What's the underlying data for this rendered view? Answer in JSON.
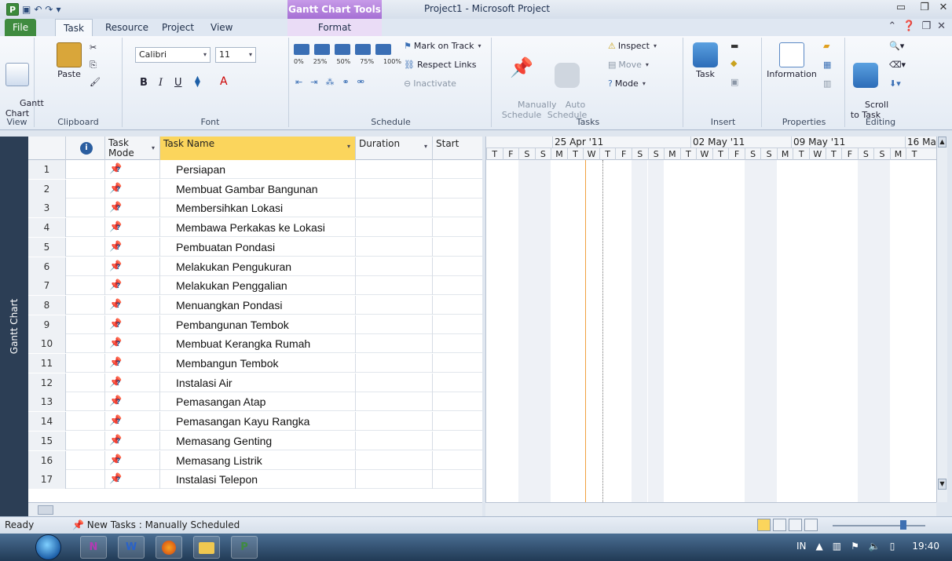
{
  "window": {
    "title": "Project1 - Microsoft Project",
    "context_group": "Gantt Chart Tools"
  },
  "tabs": [
    "File",
    "Task",
    "Resource",
    "Project",
    "View",
    "Format"
  ],
  "ribbon": {
    "view": {
      "gantt_label": "Gantt\nChart",
      "group": "View"
    },
    "clipboard": {
      "paste": "Paste",
      "group": "Clipboard"
    },
    "font": {
      "family": "Calibri",
      "size": "11",
      "bold": "B",
      "italic": "I",
      "underline": "U",
      "group": "Font"
    },
    "schedule": {
      "mark_on_track": "Mark on Track",
      "respect_links": "Respect Links",
      "inactivate": "Inactivate",
      "pct": [
        "0%",
        "25%",
        "50%",
        "75%",
        "100%"
      ],
      "group": "Schedule"
    },
    "tasks": {
      "manually": "Manually\nSchedule",
      "auto": "Auto\nSchedule",
      "inspect": "Inspect",
      "move": "Move",
      "mode": "Mode",
      "group": "Tasks"
    },
    "insert": {
      "task": "Task",
      "group": "Insert"
    },
    "properties": {
      "information": "Information",
      "group": "Properties"
    },
    "editing": {
      "scroll": "Scroll\nto Task",
      "group": "Editing"
    }
  },
  "sidebar_label": "Gantt Chart",
  "grid": {
    "headers": {
      "mode": "Task\nMode",
      "name": "Task Name",
      "duration": "Duration",
      "start": "Start"
    },
    "rows": [
      {
        "id": "1",
        "name": "Persiapan"
      },
      {
        "id": "2",
        "name": "Membuat Gambar Bangunan"
      },
      {
        "id": "3",
        "name": "Membersihkan Lokasi"
      },
      {
        "id": "4",
        "name": "Membawa Perkakas ke Lokasi"
      },
      {
        "id": "5",
        "name": "Pembuatan Pondasi"
      },
      {
        "id": "6",
        "name": "Melakukan Pengukuran"
      },
      {
        "id": "7",
        "name": "Melakukan Penggalian"
      },
      {
        "id": "8",
        "name": "Menuangkan Pondasi"
      },
      {
        "id": "9",
        "name": "Pembangunan Tembok"
      },
      {
        "id": "10",
        "name": "Membuat Kerangka Rumah"
      },
      {
        "id": "11",
        "name": "Membangun Tembok"
      },
      {
        "id": "12",
        "name": "Instalasi Air"
      },
      {
        "id": "13",
        "name": "Pemasangan Atap"
      },
      {
        "id": "14",
        "name": "Pemasangan Kayu Rangka"
      },
      {
        "id": "15",
        "name": "Memasang Genting"
      },
      {
        "id": "16",
        "name": "Memasang Listrik"
      },
      {
        "id": "17",
        "name": "Instalasi Telepon"
      }
    ]
  },
  "timescale": {
    "weeks": [
      "25 Apr '11",
      "02 May '11",
      "09 May '11",
      "16 Ma"
    ],
    "days": [
      "T",
      "F",
      "S",
      "S",
      "M",
      "T",
      "W",
      "T",
      "F",
      "S",
      "S",
      "M",
      "T",
      "W",
      "T",
      "F",
      "S",
      "S",
      "M",
      "T",
      "W",
      "T",
      "F",
      "S",
      "S",
      "M",
      "T"
    ]
  },
  "status": {
    "ready": "Ready",
    "new_tasks": "New Tasks : Manually Scheduled"
  },
  "taskbar": {
    "time": "19:40",
    "lang": "IN",
    "apps": [
      "N",
      "W",
      "",
      "",
      "P"
    ]
  }
}
